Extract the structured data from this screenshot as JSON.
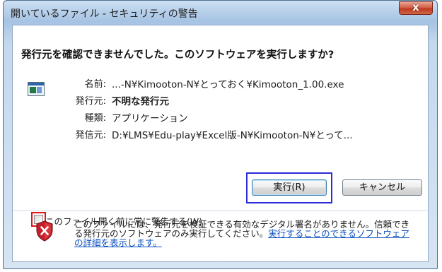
{
  "window": {
    "title": "開いているファイル - セキュリティの警告",
    "close_symbol": "x"
  },
  "dialog": {
    "question": "発行元を確認できませんでした。このソフトウェアを実行しますか?",
    "app_icon": "application-window-icon",
    "fields": [
      {
        "label": "名前:",
        "value": "...-N¥Kimooton-N¥とっておく¥Kimooton_1.00.exe",
        "bold": false
      },
      {
        "label": "発行元:",
        "value": "不明な発行元",
        "bold": true
      },
      {
        "label": "種類:",
        "value": "アプリケーション",
        "bold": false
      },
      {
        "label": "発信元:",
        "value": "D:¥LMS¥Edu-play¥Excel版-N¥Kimooton-N¥とって...",
        "bold": false
      }
    ],
    "run_button": "実行(R)",
    "cancel_button": "キャンセル",
    "checkbox_label": "このファイル開く前に常に警告する(W)",
    "checkbox_checked": false,
    "warning_icon": "red-shield-x-icon",
    "warning_text": "このファイルには、発行元を検証できる有効なデジタル署名がありません。信頼できる発行元のソフトウェアのみ実行してください。",
    "warning_link": "実行することのできるソフトウェアの詳細を表示します。"
  },
  "colors": {
    "highlight_run_button": "#2b2bd8",
    "highlight_checkbox": "#e0141a",
    "link": "#0a4fbf"
  }
}
